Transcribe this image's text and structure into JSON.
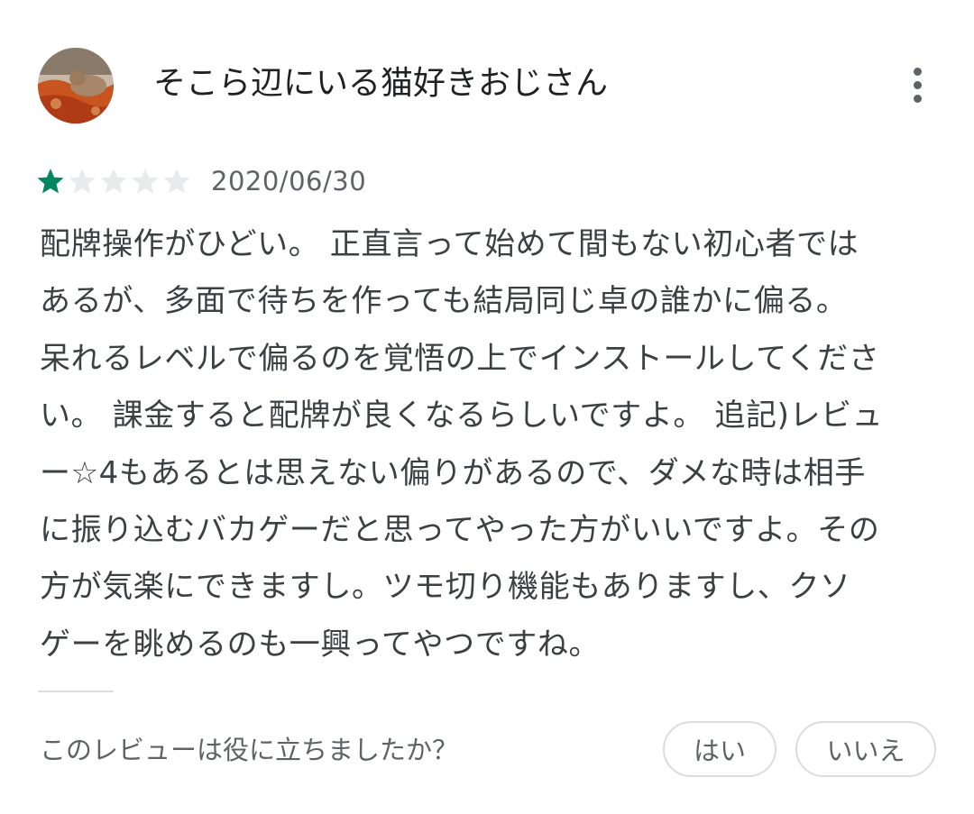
{
  "review": {
    "author": "そこら辺にいる猫好きおじさん",
    "avatar_icon": "user-avatar-cat-photo",
    "more_icon": "more-vert-icon",
    "rating": 1,
    "max_rating": 5,
    "star_filled_color": "#01875f",
    "star_empty_color": "#e8eaed",
    "date": "2020/06/30",
    "text_lines": [
      "配牌操作がひどい。 正直言って始めて間もない初心者では",
      "あるが、多面で待ちを作っても結局同じ卓の誰かに偏る。",
      "呆れるレベルで偏るのを覚悟の上でインストールしてくださ",
      "い。 課金すると配牌が良くなるらしいですよ。 追記)レビュ",
      "ー☆4もあるとは思えない偏りがあるので、ダメな時は相手",
      "に振り込むバカゲーだと思ってやった方がいいですよ。その",
      "方が気楽にできますし。ツモ切り機能もありますし、クソ",
      "ゲーを眺めるのも一興ってやつですね。"
    ]
  },
  "helpful": {
    "question": "このレビューは役に立ちましたか？",
    "yes_label": "はい",
    "no_label": "いいえ"
  }
}
